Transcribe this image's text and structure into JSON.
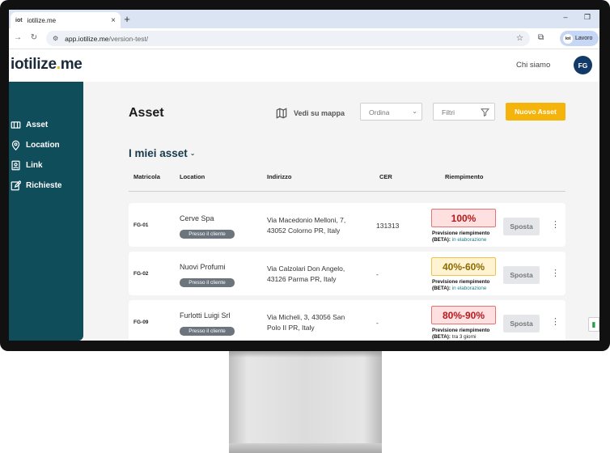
{
  "browser": {
    "tab_title": "iotilize.me",
    "tab_favicon": "iot",
    "new_tab": "+",
    "url_host": "app.iotilize.me",
    "url_path": "/version-test/",
    "profile_initials": "iot",
    "profile_label": "Lavoro"
  },
  "header": {
    "logo_main": "iotilize",
    "logo_dot": ".",
    "logo_tail": "me",
    "about_link": "Chi siamo",
    "avatar_initials": "FG"
  },
  "sidebar": {
    "items": [
      {
        "label": "Asset",
        "icon": "asset-icon"
      },
      {
        "label": "Location",
        "icon": "location-pin-icon"
      },
      {
        "label": "Link",
        "icon": "link-card-icon"
      },
      {
        "label": "Richieste",
        "icon": "edit-request-icon"
      }
    ]
  },
  "main": {
    "title": "Asset",
    "map_button": "Vedi su mappa",
    "sort_placeholder": "Ordina",
    "filter_placeholder": "Filtri",
    "new_asset_button": "Nuovo Asset",
    "section_title": "I miei asset"
  },
  "table": {
    "columns": [
      "Matricola",
      "Location",
      "Indirizzo",
      "CER",
      "Riempimento"
    ],
    "forecast_label": "Previsione riempimento",
    "forecast_beta": "(BETA):",
    "move_label": "Sposta",
    "rows": [
      {
        "code": "FG-01",
        "location": "Cerve Spa",
        "badge": "Presso il cliente",
        "address_line1": "Via Macedonio Melloni, 7,",
        "address_line2": "43052 Colorno PR, Italy",
        "cer": "131313",
        "fill": "100%",
        "fill_level": "red",
        "forecast_status": "in elaborazione"
      },
      {
        "code": "FG-02",
        "location": "Nuovi Profumi",
        "badge": "Presso il cliente",
        "address_line1": "Via Calzolari Don Angelo,",
        "address_line2": "43126 Parma PR, Italy",
        "cer": "-",
        "fill": "40%-60%",
        "fill_level": "yellow",
        "forecast_status": "in elaborazione"
      },
      {
        "code": "FG-09",
        "location": "Furlotti Luigi Srl",
        "badge": "Presso il cliente",
        "address_line1": "Via Micheli, 3, 43056 San",
        "address_line2": "Polo II PR, Italy",
        "cer": "-",
        "fill": "80%-90%",
        "fill_level": "red",
        "forecast_status": "tra 3 giorni"
      }
    ]
  },
  "colors": {
    "sidebar": "#104d5b",
    "accent": "#f5b40c",
    "avatar": "#123a69"
  }
}
